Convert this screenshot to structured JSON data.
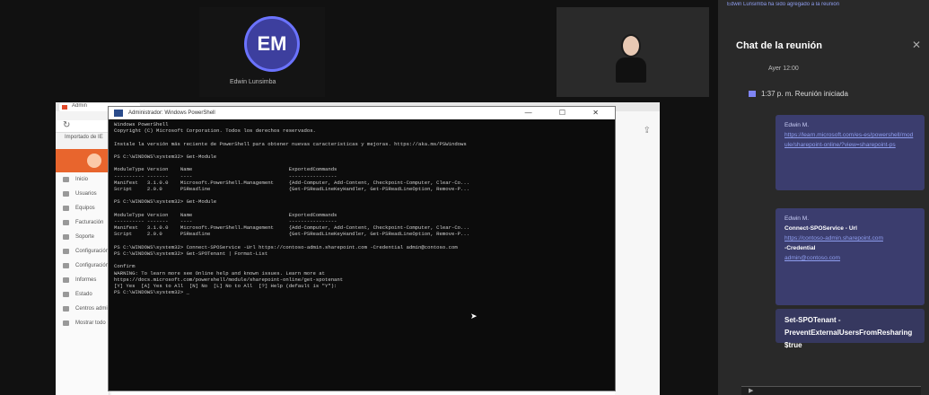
{
  "participants": [
    {
      "initials": "EM",
      "name": "Edwin Lunsimba"
    }
  ],
  "browser": {
    "tab_label": "Admin",
    "bookmarks": "Importado de IE",
    "nav_items": [
      "Inicio",
      "Usuarios",
      "Equipos",
      "Facturación",
      "Soporte",
      "Configuración",
      "Configuración",
      "Informes",
      "Estado",
      "Centros admin",
      "Mostrar todo"
    ]
  },
  "console": {
    "window_title": "Administrador: Windows PowerShell",
    "controls": "— ☐ ✕",
    "lines": [
      "Windows PowerShell",
      "Copyright (C) Microsoft Corporation. Todos los derechos reservados.",
      "",
      "Instale la versión más reciente de PowerShell para obtener nuevas características y mejoras. https://aka.ms/PSWindows",
      "",
      "PS C:\\WINDOWS\\system32> Get-Module",
      "",
      "ModuleType Version    Name                                ExportedCommands",
      "---------- -------    ----                                ----------------",
      "Manifest   3.1.0.0    Microsoft.PowerShell.Management     {Add-Computer, Add-Content, Checkpoint-Computer, Clear-Co...",
      "Script     2.0.0      PSReadline                          {Get-PSReadLineKeyHandler, Get-PSReadLineOption, Remove-P...",
      "",
      "PS C:\\WINDOWS\\system32> Get-Module",
      "",
      "ModuleType Version    Name                                ExportedCommands",
      "---------- -------    ----                                ----------------",
      "Manifest   3.1.0.0    Microsoft.PowerShell.Management     {Add-Computer, Add-Content, Checkpoint-Computer, Clear-Co...",
      "Script     2.0.0      PSReadline                          {Get-PSReadLineKeyHandler, Get-PSReadLineOption, Remove-P...",
      "",
      "PS C:\\WINDOWS\\system32> Connect-SPOService -Url https://contoso-admin.sharepoint.com -Credential admin@contoso.com",
      "PS C:\\WINDOWS\\system32> Get-SPOTenant | Format-List",
      "",
      "Confirm",
      "WARNING: To learn more see Online help and known issues. Learn more at",
      "https://docs.microsoft.com/powershell/module/sharepoint-online/get-spotenant",
      "[Y] Yes  [A] Yes to All  [N] No  [L] No to All  [?] Help (default is \"Y\"):",
      "PS C:\\WINDOWS\\system32> _"
    ]
  },
  "chat": {
    "banner": "Edwin Lunsimba ha sido agregado a la reunión",
    "title": "Chat de la reunión",
    "date": "Ayer 12:00",
    "meeting_label": "1:37 p. m.  Reunión iniciada",
    "message1": {
      "label": "Edwin M.",
      "link": "https://learn.microsoft.com/es-es/powershell/module/sharepoint-online/?view=sharepoint-ps"
    },
    "message2": {
      "label": "Edwin M.",
      "title": "Connect-SPOService - Url",
      "link": "https://contoso-admin.sharepoint.com",
      "credential_label": "-Credential",
      "credential_link": "admin@contoso.com"
    },
    "message3": {
      "text": "Set-SPOTenant - PreventExternalUsersFromResharing $true"
    }
  }
}
